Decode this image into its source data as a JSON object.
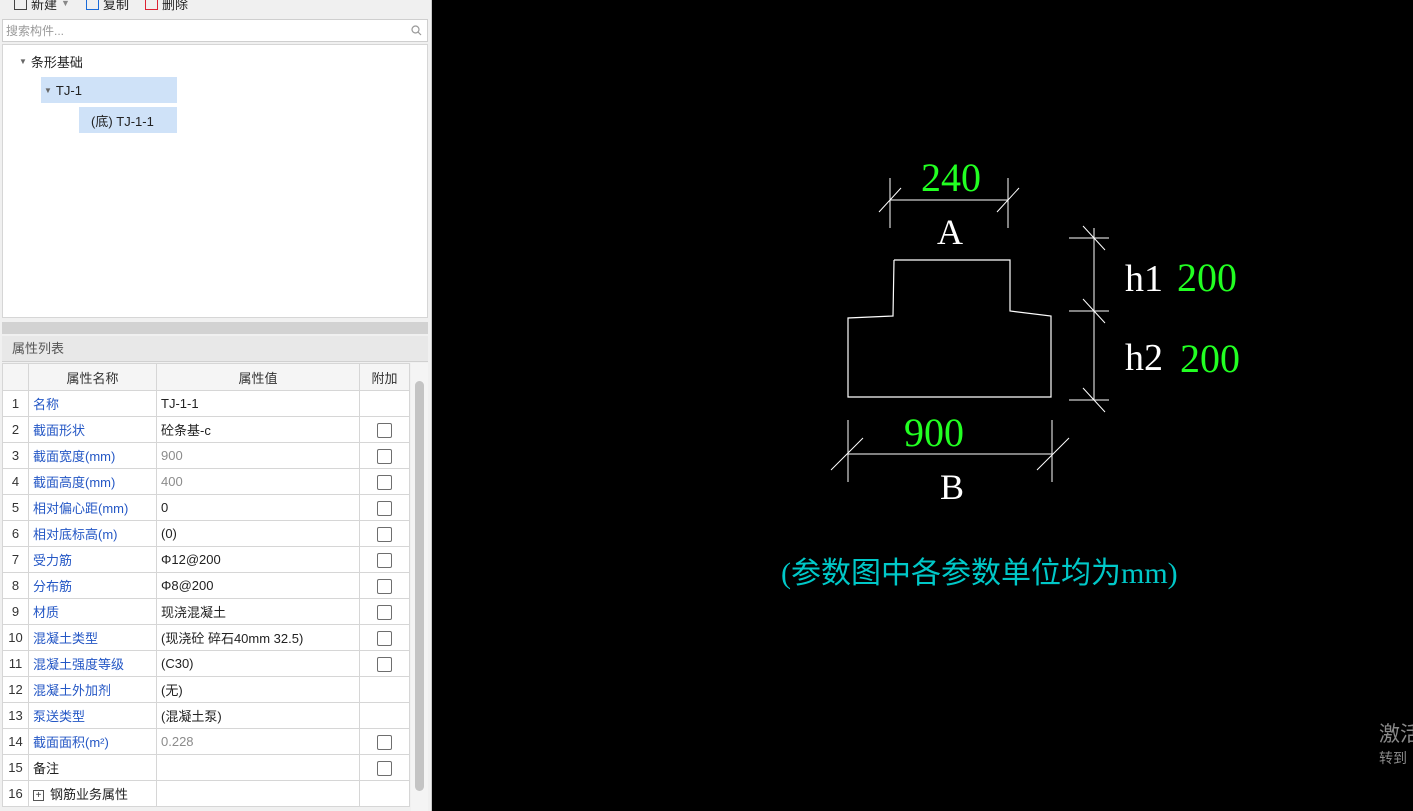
{
  "toolbar": {
    "new_label": "新建",
    "copy_label": "复制",
    "delete_label": "删除"
  },
  "search": {
    "placeholder": "搜索构件..."
  },
  "tree": {
    "root": "条形基础",
    "group": "TJ-1",
    "leaf": "(底) TJ-1-1"
  },
  "props": {
    "title": "属性列表",
    "headers": {
      "name": "属性名称",
      "value": "属性值",
      "extra": "附加"
    },
    "rows": [
      {
        "n": "1",
        "name": "名称",
        "value": "TJ-1-1",
        "has_cb": false,
        "grey": false,
        "blue": true
      },
      {
        "n": "2",
        "name": "截面形状",
        "value": "砼条基-c",
        "has_cb": true,
        "grey": false,
        "blue": true
      },
      {
        "n": "3",
        "name": "截面宽度(mm)",
        "value": "900",
        "has_cb": true,
        "grey": true,
        "blue": true
      },
      {
        "n": "4",
        "name": "截面高度(mm)",
        "value": "400",
        "has_cb": true,
        "grey": true,
        "blue": true
      },
      {
        "n": "5",
        "name": "相对偏心距(mm)",
        "value": "0",
        "has_cb": true,
        "grey": false,
        "blue": true
      },
      {
        "n": "6",
        "name": "相对底标高(m)",
        "value": "(0)",
        "has_cb": true,
        "grey": false,
        "blue": true
      },
      {
        "n": "7",
        "name": "受力筋",
        "value": "Φ12@200",
        "has_cb": true,
        "grey": false,
        "blue": true
      },
      {
        "n": "8",
        "name": "分布筋",
        "value": "Φ8@200",
        "has_cb": true,
        "grey": false,
        "blue": true
      },
      {
        "n": "9",
        "name": "材质",
        "value": "现浇混凝土",
        "has_cb": true,
        "grey": false,
        "blue": true
      },
      {
        "n": "10",
        "name": "混凝土类型",
        "value": "(现浇砼 碎石40mm 32.5)",
        "has_cb": true,
        "grey": false,
        "blue": true
      },
      {
        "n": "11",
        "name": "混凝土强度等级",
        "value": "(C30)",
        "has_cb": true,
        "grey": false,
        "blue": true
      },
      {
        "n": "12",
        "name": "混凝土外加剂",
        "value": "(无)",
        "has_cb": false,
        "grey": false,
        "blue": true
      },
      {
        "n": "13",
        "name": "泵送类型",
        "value": "(混凝土泵)",
        "has_cb": false,
        "grey": false,
        "blue": true
      },
      {
        "n": "14",
        "name": "截面面积(m²)",
        "value": "0.228",
        "has_cb": true,
        "grey": true,
        "blue": true
      },
      {
        "n": "15",
        "name": "备注",
        "value": "",
        "has_cb": true,
        "grey": false,
        "blue": false
      },
      {
        "n": "16",
        "name": "钢筋业务属性",
        "value": "",
        "has_cb": false,
        "grey": false,
        "blue": false,
        "expand": true
      }
    ]
  },
  "drawing": {
    "top_width": "240",
    "top_label": "A",
    "h1_label": "h1",
    "h1_value": "200",
    "h2_label": "h2",
    "h2_value": "200",
    "bottom_width": "900",
    "bottom_label": "B",
    "note": "(参数图中各参数单位均为mm)",
    "colors": {
      "value": "#22ff22",
      "note": "#00c8c8",
      "line": "#ffffff"
    }
  },
  "watermark": {
    "line1": "激活",
    "line2": "转到"
  }
}
